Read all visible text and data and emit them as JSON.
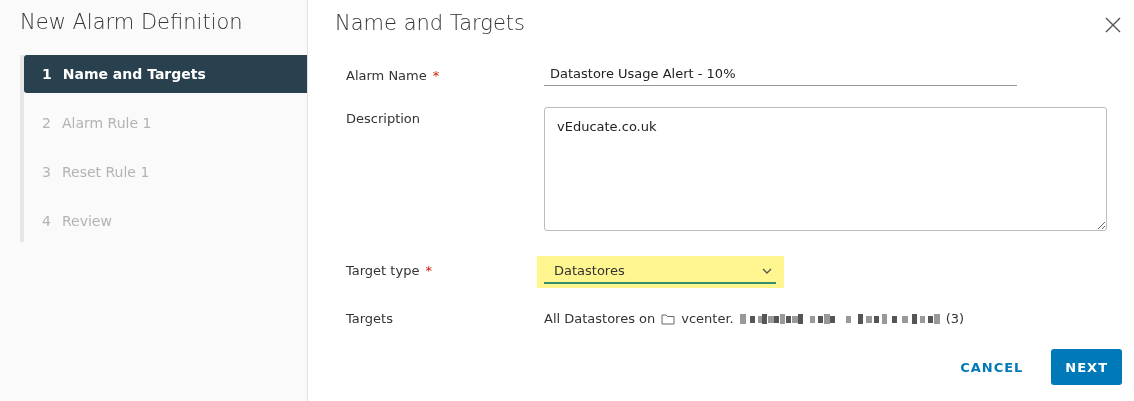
{
  "sidebar": {
    "title": "New Alarm Definition",
    "steps": [
      {
        "number": "1",
        "label": "Name and Targets",
        "selected": true
      },
      {
        "number": "2",
        "label": "Alarm Rule 1",
        "selected": false
      },
      {
        "number": "3",
        "label": "Reset Rule 1",
        "selected": false
      },
      {
        "number": "4",
        "label": "Review",
        "selected": false
      }
    ]
  },
  "main": {
    "title": "Name and Targets",
    "fields": [
      {
        "kind": "input",
        "label": "Alarm Name",
        "required_mark": "*",
        "value": "Datastore Usage Alert - 10%"
      },
      {
        "kind": "textarea",
        "label": "Description",
        "value": "vEducate.co.uk"
      },
      {
        "kind": "select",
        "label": "Target type",
        "required_mark": "*",
        "value": "Datastores",
        "highlighted": true
      },
      {
        "kind": "targets",
        "label": "Targets",
        "prefix": "All Datastores on",
        "host": "vcenter.",
        "count": "(3)"
      }
    ],
    "buttons": [
      {
        "kind": "flat",
        "label": "CANCEL"
      },
      {
        "kind": "primary",
        "label": "NEXT"
      }
    ]
  }
}
